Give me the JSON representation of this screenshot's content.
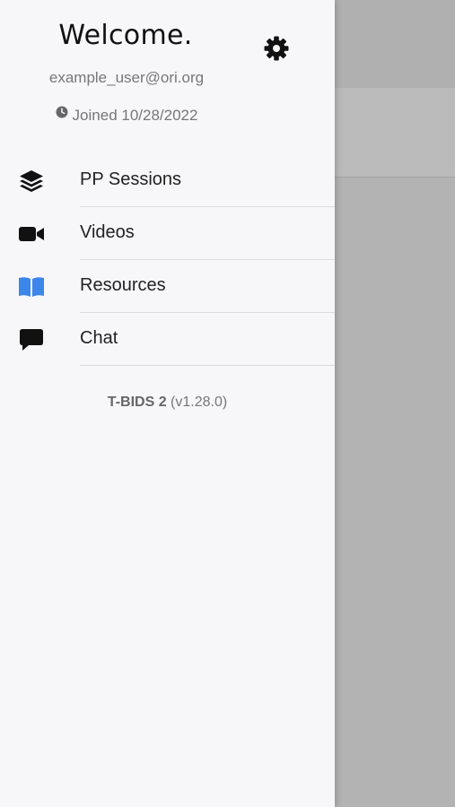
{
  "drawer": {
    "greeting": "Welcome.",
    "email": "example_user@ori.org",
    "joined": "Joined 10/28/2022",
    "menu": [
      {
        "label": "PP Sessions",
        "icon": "layers-icon"
      },
      {
        "label": "Videos",
        "icon": "video-camera-icon"
      },
      {
        "label": "Resources",
        "icon": "open-book-icon",
        "color": "#3b86e8"
      },
      {
        "label": "Chat",
        "icon": "chat-bubble-icon"
      }
    ],
    "app_name": "T-BIDS 2",
    "version": "(v1.28.0)"
  },
  "background": {
    "chevron_icon": "chevron-down-icon"
  },
  "colors": {
    "drawer_bg": "#f7f7fa",
    "accent_blue": "#3b86e8",
    "overlay": "#b3b3b3"
  }
}
